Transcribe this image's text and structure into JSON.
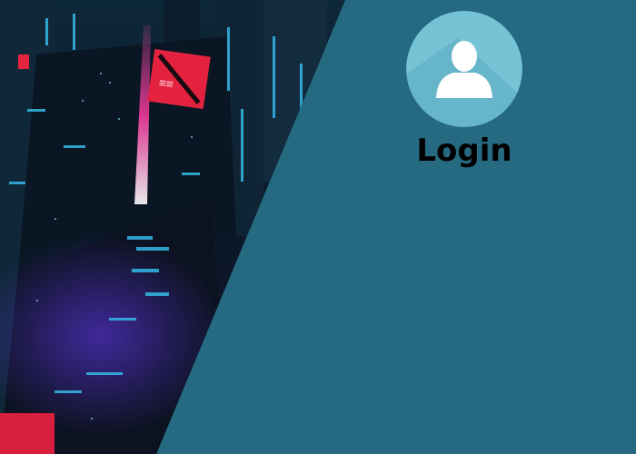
{
  "login": {
    "title": "Login",
    "avatar_icon": "user-silhouette-icon"
  },
  "colors": {
    "panel_background": "#256a80",
    "avatar_circle": "#76c3d6",
    "avatar_shadow": "#5aa9bd",
    "user_silhouette": "#ffffff",
    "title_text": "#000000",
    "neon_pink": "#ff2a8a",
    "neon_cyan": "#35b9e8"
  },
  "background": {
    "image": "cyberpunk-city-night-illustration"
  }
}
